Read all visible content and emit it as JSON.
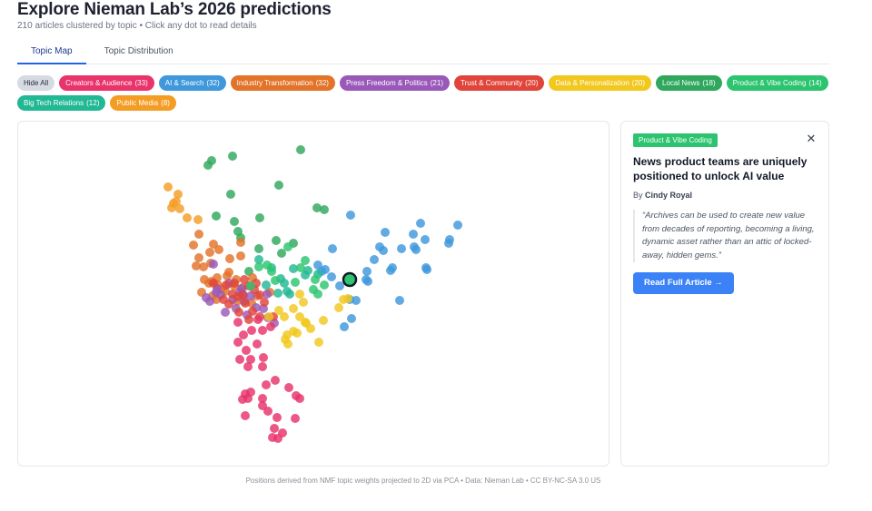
{
  "header": {
    "title": "Explore Nieman Lab’s 2026 predictions",
    "subtitle": "210 articles clustered by topic • Click any dot to read details"
  },
  "tabs": [
    {
      "label": "Topic Map",
      "active": true
    },
    {
      "label": "Topic Distribution",
      "active": false
    }
  ],
  "filters": {
    "hide_all_label": "Hide All",
    "topics": [
      {
        "label": "Creators & Audience",
        "count": "(33)",
        "color": "#e8336b"
      },
      {
        "label": "AI & Search",
        "count": "(32)",
        "color": "#3f98dc"
      },
      {
        "label": "Industry Transformation",
        "count": "(32)",
        "color": "#e37329"
      },
      {
        "label": "Press Freedom & Politics",
        "count": "(21)",
        "color": "#9a59b9"
      },
      {
        "label": "Trust & Community",
        "count": "(20)",
        "color": "#e0443a"
      },
      {
        "label": "Data & Personalization",
        "count": "(20)",
        "color": "#f2c81e"
      },
      {
        "label": "Local News",
        "count": "(18)",
        "color": "#2fa85d"
      },
      {
        "label": "Product & Vibe Coding",
        "count": "(14)",
        "color": "#2cc46f"
      },
      {
        "label": "Big Tech Relations",
        "count": "(12)",
        "color": "#22b894"
      },
      {
        "label": "Public Media",
        "count": "(8)",
        "color": "#f49d24"
      }
    ]
  },
  "detail": {
    "badge": "Product & Vibe Coding",
    "badge_color": "#2cc46f",
    "close_icon": "close-icon",
    "title": "News product teams are uniquely positioned to unlock AI value",
    "byline_prefix": "By",
    "author": "Cindy Royal",
    "quote": "“Archives can be used to create new value from decades of reporting, becoming a living, dynamic asset rather than an attic of locked-away, hidden gems.”",
    "button_label": "Read Full Article →"
  },
  "footer": {
    "note": "Positions derived from NMF topic weights projected to 2D via PCA • Data: Nieman Lab • CC BY-NC-SA 3.0 US"
  }
}
